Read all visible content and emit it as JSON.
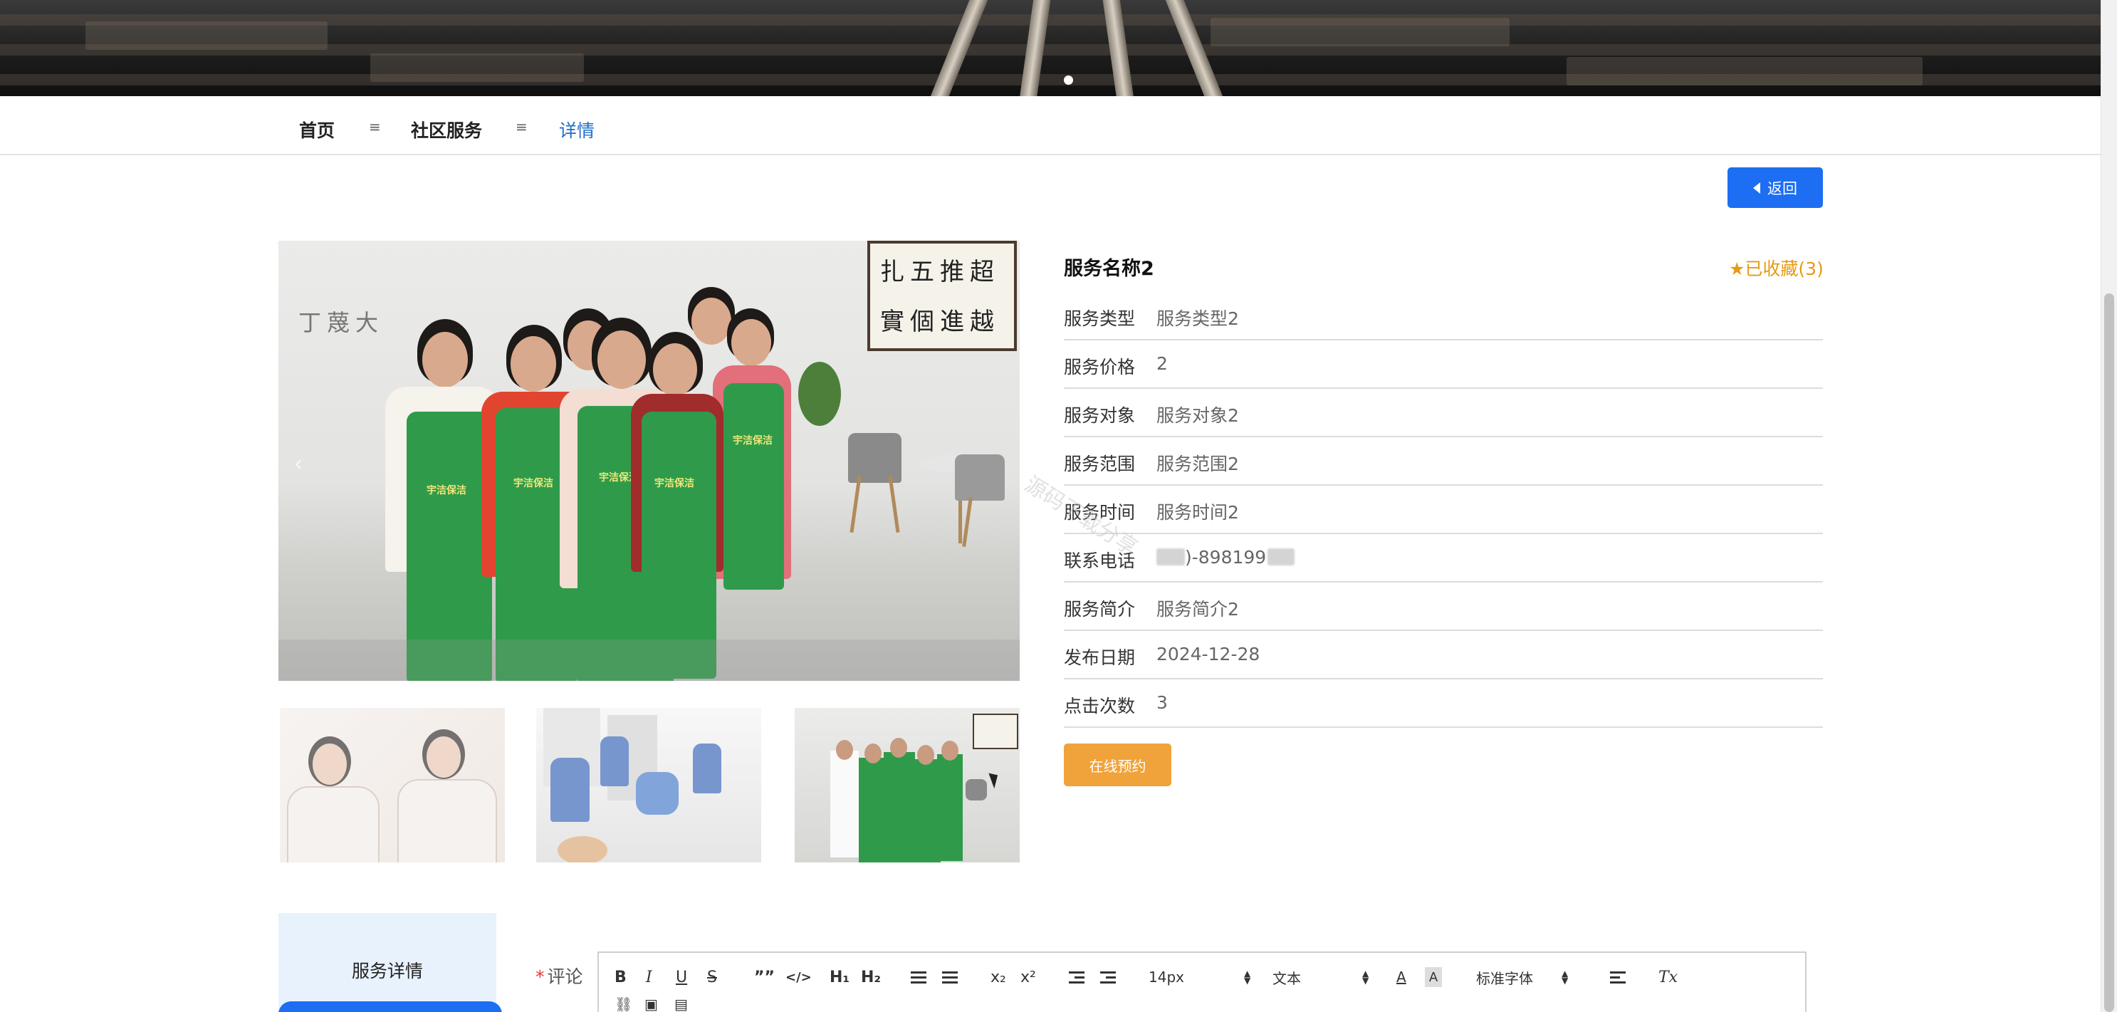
{
  "breadcrumb": {
    "home": "首页",
    "section": "社区服务",
    "current": "详情",
    "separator": "≡"
  },
  "back_button": {
    "label": "返回"
  },
  "service": {
    "title": "服务名称2",
    "favorite": "已收藏(3)",
    "fields": [
      {
        "label": "服务类型",
        "value": "服务类型2"
      },
      {
        "label": "服务价格",
        "value": "2"
      },
      {
        "label": "服务对象",
        "value": "服务对象2"
      },
      {
        "label": "服务范围",
        "value": "服务范围2"
      },
      {
        "label": "服务时间",
        "value": "服务时间2"
      },
      {
        "label": "联系电话",
        "value": ")-898199"
      },
      {
        "label": "服务简介",
        "value": "服务简介2"
      },
      {
        "label": "发布日期",
        "value": "2024-12-28"
      },
      {
        "label": "点击次数",
        "value": "3"
      }
    ],
    "book_button": "在线预约"
  },
  "photo": {
    "calligraphy_line1": "扎五推超",
    "calligraphy_line2": "實個進越",
    "wall_text": "丁蔑大",
    "apron_text": "宇洁保洁"
  },
  "watermark": "源码下载分享",
  "tabs": {
    "active": "服务详情"
  },
  "comment": {
    "required_mark": "*",
    "label": "评论"
  },
  "editor_toolbar": {
    "bold": "B",
    "italic": "I",
    "underline": "U",
    "strike": "S",
    "quote": "””",
    "code": "</>",
    "h1": "H₁",
    "h2": "H₂",
    "subscript": "x₂",
    "superscript": "x²",
    "size": "14px",
    "format": "文本",
    "font": "标准字体",
    "clear": "Tx"
  },
  "colors": {
    "primary": "#1d6ef2",
    "accent": "#f0a33a",
    "favorite": "#e69a16",
    "breadcrumb_active": "#1f6fc9",
    "tab_bg": "#e8f2fd"
  }
}
